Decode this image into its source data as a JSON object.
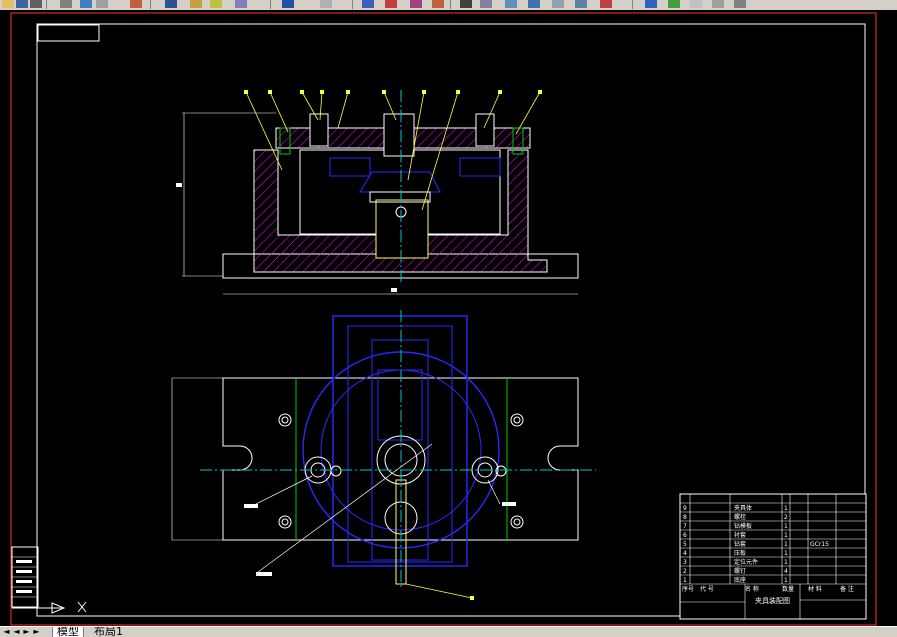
{
  "toolbar": {
    "icons": [
      "open-icon",
      "save-icon",
      "print-icon",
      "preview-icon",
      "cut-icon",
      "copy-icon",
      "paste-icon",
      "match-icon",
      "undo-icon",
      "redo-icon",
      "pan-icon",
      "zoom-icon",
      "zoom-window-icon",
      "zoom-previous-icon",
      "properties-icon",
      "design-center-icon",
      "tool-palette-icon",
      "sheet-set-icon",
      "markup-icon",
      "calc-icon",
      "layer-icon",
      "layer-prev-icon",
      "color-icon"
    ]
  },
  "drawing": {
    "title_block": {
      "drawing_title": "夹具装配图",
      "parts_header": [
        "序号",
        "代 号",
        "名 称",
        "数量",
        "材 料",
        "备 注"
      ],
      "material_note": "GCr15",
      "rows": [
        {
          "no": "1",
          "name": "底座",
          "qty": "1"
        },
        {
          "no": "2",
          "name": "螺钉",
          "qty": "4"
        },
        {
          "no": "3",
          "name": "定位元件",
          "qty": "1"
        },
        {
          "no": "4",
          "name": "压板",
          "qty": "1"
        },
        {
          "no": "5",
          "name": "钻套",
          "qty": "1"
        },
        {
          "no": "6",
          "name": "衬套",
          "qty": "1"
        },
        {
          "no": "7",
          "name": "钻模板",
          "qty": "1"
        },
        {
          "no": "8",
          "name": "螺栓",
          "qty": "2"
        },
        {
          "no": "9",
          "name": "夹具体",
          "qty": "1"
        }
      ]
    }
  },
  "tabs": {
    "model": "模型",
    "layout1": "布局1"
  },
  "colors": {
    "background": "#000000",
    "frame": "#ffffff",
    "hatch": "#ff00ff",
    "part_blue": "#2a2aff",
    "center_line": "#00c8c8",
    "leader": "#ffff00",
    "green": "#00c800",
    "dimension": "#ffffff",
    "crosshair": "#ff0000"
  }
}
